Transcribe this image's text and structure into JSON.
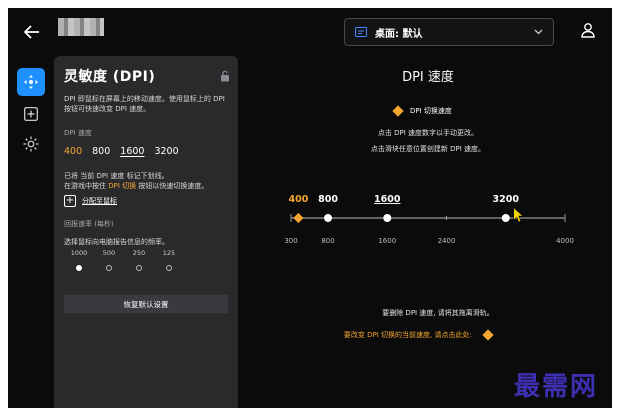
{
  "header": {
    "profile_label": "桌面: 默认"
  },
  "panel": {
    "title": "灵敏度 (DPI)",
    "description": "DPI 即鼠标在屏幕上的移动速度。使用鼠标上的 DPI 按钮可快速改变 DPI 速度。",
    "dpi_section_label": "DPI 速度",
    "dpi_presets": [
      "400",
      "800",
      "1600",
      "3200"
    ],
    "hint_line1": "已将 当前 DPI 速度 标记下划线。",
    "hint_line2_prefix": "在游戏中按住 ",
    "hint_line2_link": "DPI 切换",
    "hint_line2_suffix": " 按钮以快速切换速度。",
    "assign_label": "分配至鼠标",
    "report_rate_label": "回报速率 (每秒)",
    "report_rate_desc": "选择鼠标向电脑报告信息的频率。",
    "report_rates": [
      "1000",
      "500",
      "250",
      "125"
    ],
    "report_rate_selected": 0,
    "reset_label": "恢复默认设置"
  },
  "main": {
    "title": "DPI 速度",
    "legend_label": "DPI 切换速度",
    "info_line1": "点击 DPI 速度数字以手动更改。",
    "info_line2": "点击滑块任意位置创建新 DPI 速度。",
    "footer_remove": "要删除 DPI 速度, 请将其拖离滑轨。",
    "footer_change": "要改变 DPI 切换的当前速度, 请点击此处:"
  },
  "chart_data": {
    "type": "scatter",
    "axis_min": 300,
    "axis_max": 4000,
    "tick_labels": [
      "300",
      "800",
      "1600",
      "2400",
      "4000"
    ],
    "tick_values": [
      300,
      800,
      1600,
      2400,
      4000
    ],
    "points": [
      {
        "value": 400,
        "label": "400",
        "kind": "shift"
      },
      {
        "value": 800,
        "label": "800",
        "kind": "normal"
      },
      {
        "value": 1600,
        "label": "1600",
        "kind": "current"
      },
      {
        "value": 3200,
        "label": "3200",
        "kind": "normal"
      }
    ],
    "colors": {
      "shift": "#f4a630",
      "normal": "#ffffff",
      "track": "#9a9a9a"
    }
  },
  "watermark": "最需网"
}
